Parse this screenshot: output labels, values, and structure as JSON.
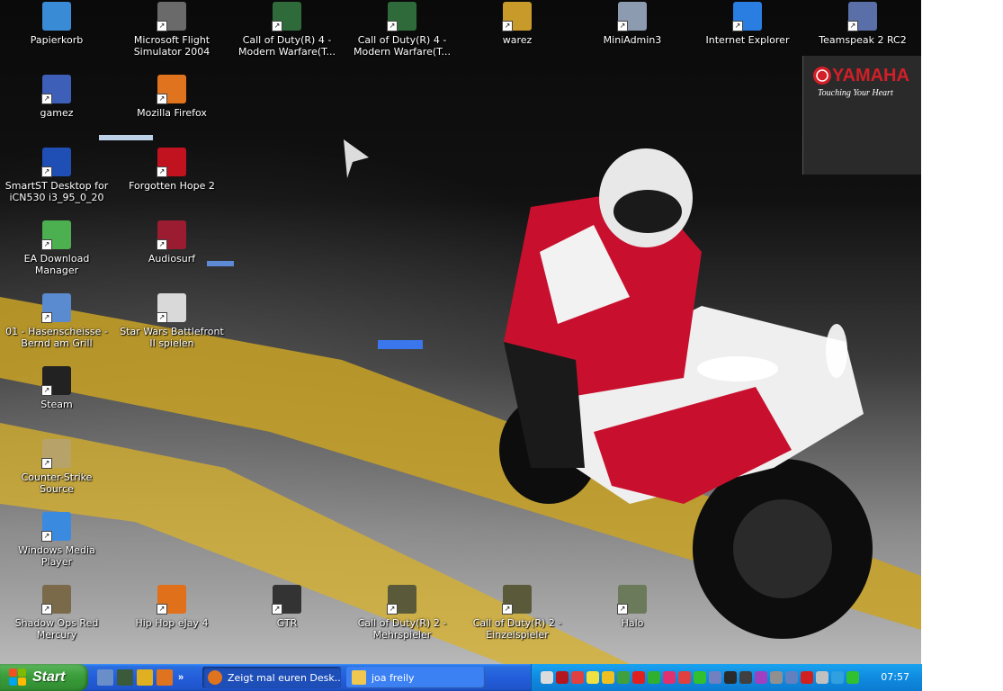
{
  "desktop": {
    "icons": [
      {
        "label": "Papierkorb",
        "icon": "recycle-bin-icon",
        "color": "#3a8bd6"
      },
      {
        "label": "Microsoft Flight Simulator 2004",
        "icon": "airplane-icon",
        "color": "#6a6a6a"
      },
      {
        "label": "Call of Duty(R) 4 - Modern Warfare(T...",
        "icon": "cod4-icon",
        "color": "#2f6b3a"
      },
      {
        "label": "Call of Duty(R) 4 - Modern Warfare(T...",
        "icon": "cod4-icon",
        "color": "#2f6b3a"
      },
      {
        "label": "warez",
        "icon": "disk-icon",
        "color": "#c79a2a"
      },
      {
        "label": "MiniAdmin3",
        "icon": "computer-icon",
        "color": "#8c9bb0"
      },
      {
        "label": "Internet Explorer",
        "icon": "internet-explorer-icon",
        "color": "#2a7de1"
      },
      {
        "label": "Teamspeak 2 RC2",
        "icon": "teamspeak-icon",
        "color": "#5a6fa8"
      },
      {
        "label": "gamez",
        "icon": "folder-icon",
        "color": "#3e5fb8"
      },
      {
        "label": "Mozilla Firefox",
        "icon": "firefox-icon",
        "color": "#e0731e"
      },
      {
        "label": "SmartST Desktop for iCN530 i3_95_0_20",
        "icon": "navigation-icon",
        "color": "#1f4fb5"
      },
      {
        "label": "Forgotten Hope 2",
        "icon": "fh2-icon",
        "color": "#c1121f"
      },
      {
        "label": "EA Download Manager",
        "icon": "ea-icon",
        "color": "#4caf50"
      },
      {
        "label": "Audiosurf",
        "icon": "audiosurf-icon",
        "color": "#9b1b30"
      },
      {
        "label": "01 - Hasenscheisse - Bernd am Grill",
        "icon": "media-file-icon",
        "color": "#5a8ad0"
      },
      {
        "label": "Star Wars Battlefront II spielen",
        "icon": "clone-trooper-icon",
        "color": "#d9d9d9"
      },
      {
        "label": "Steam",
        "icon": "steam-icon",
        "color": "#222222"
      },
      {
        "label": "Counter-Strike Source",
        "icon": "counter-strike-icon",
        "color": "#b7a36a"
      },
      {
        "label": "Windows Media Player",
        "icon": "media-player-icon",
        "color": "#3a8be0"
      },
      {
        "label": "Shadow Ops  Red Mercury",
        "icon": "shadow-ops-icon",
        "color": "#7a6a4a"
      },
      {
        "label": "Hip Hop eJay 4",
        "icon": "ejay-icon",
        "color": "#e0701a"
      },
      {
        "label": "GTR",
        "icon": "gtr-icon",
        "color": "#333333"
      },
      {
        "label": "Call of Duty(R) 2 - Mehrspieler",
        "icon": "cod2-icon",
        "color": "#5a5a3a"
      },
      {
        "label": "Call of Duty(R) 2 - Einzelspieler",
        "icon": "cod2-icon",
        "color": "#5a5a3a"
      },
      {
        "label": "Halo",
        "icon": "halo-icon",
        "color": "#6a7a5a"
      }
    ],
    "yamaha": {
      "brand": "YAMAHA",
      "tagline": "Touching Your Heart"
    }
  },
  "taskbar": {
    "start_label": "Start",
    "quicklaunch": [
      {
        "icon": "show-desktop-icon",
        "color": "#6a8fc8"
      },
      {
        "icon": "screen-icon",
        "color": "#3a5a3a"
      },
      {
        "icon": "flag-icon",
        "color": "#e0b020"
      },
      {
        "icon": "firefox-icon",
        "color": "#e0731e"
      }
    ],
    "quicklaunch_more": "»",
    "tasks": [
      {
        "label": "Zeigt mal euren Desk...",
        "icon": "firefox-icon",
        "color": "#e0731e",
        "active": true
      },
      {
        "label": "joa freily",
        "icon": "folder-icon",
        "color": "#f0c850",
        "active": false
      }
    ],
    "tray_icons": [
      {
        "icon": "network-icon",
        "color": "#dcdcdc"
      },
      {
        "icon": "yamaha-tray-icon",
        "color": "#b3161f"
      },
      {
        "icon": "antivirus-icon",
        "color": "#e04040"
      },
      {
        "icon": "lightning-icon",
        "color": "#f0e040"
      },
      {
        "icon": "shield-icon",
        "color": "#f0c020"
      },
      {
        "icon": "users-icon",
        "color": "#40a040"
      },
      {
        "icon": "ati-icon",
        "color": "#e02020"
      },
      {
        "icon": "clover-icon",
        "color": "#30b030"
      },
      {
        "icon": "messenger-icon",
        "color": "#e03070"
      },
      {
        "icon": "security-icon",
        "color": "#e04040"
      },
      {
        "icon": "green-icon",
        "color": "#30c030"
      },
      {
        "icon": "teamspeak-icon",
        "color": "#7080c0"
      },
      {
        "icon": "steam-icon",
        "color": "#2a2a2a"
      },
      {
        "icon": "monitor-icon",
        "color": "#404040"
      },
      {
        "icon": "chat-icon",
        "color": "#a040c0"
      },
      {
        "icon": "gear-icon",
        "color": "#909090"
      },
      {
        "icon": "card-icon",
        "color": "#6080c0"
      },
      {
        "icon": "ati-catalyst-icon",
        "color": "#d02020"
      },
      {
        "icon": "speaker-icon",
        "color": "#c0c0c0"
      },
      {
        "icon": "network-monitor-icon",
        "color": "#30a0e0"
      },
      {
        "icon": "wifi-icon",
        "color": "#30c030"
      }
    ],
    "clock": "07:57"
  }
}
